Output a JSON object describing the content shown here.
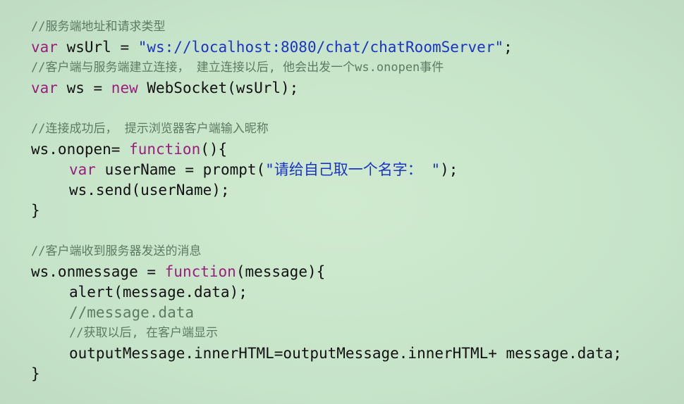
{
  "code": {
    "c1": "//服务端地址和请求类型",
    "l1": {
      "kw": "var",
      "rest": " wsUrl = ",
      "str": "\"ws://localhost:8080/chat/chatRoomServer\"",
      "end": ";"
    },
    "c2": "//客户端与服务端建立连接， 建立连接以后, 他会出发一个ws.onopen事件",
    "l2": {
      "kw": "var",
      "rest1": " ws = ",
      "kw2": "new",
      "rest2": " WebSocket(wsUrl);"
    },
    "c3": "//连接成功后， 提示浏览器客户端输入昵称",
    "l3": {
      "pre": "ws.onopen= ",
      "kw": "function",
      "post": "(){"
    },
    "l4": {
      "kw": "var",
      "rest": " userName = prompt(",
      "str": "\"请给自己取一个名字： \"",
      "end": ");"
    },
    "l5": "ws.send(userName);",
    "l6": "}",
    "c4": "//客户端收到服务器发送的消息",
    "l7": {
      "pre": "ws.onmessage = ",
      "kw": "function",
      "post": "(message){"
    },
    "l8": "alert(message.data);",
    "l9": "//message.data",
    "c5": "//获取以后, 在客户端显示",
    "l10": "outputMessage.innerHTML=outputMessage.innerHTML+ message.data;",
    "l11": "}"
  },
  "colors": {
    "background": "#c8e6cc",
    "keyword": "#9b1d7d",
    "string": "#1b33c6",
    "comment": "#5c7b63",
    "text": "#111111"
  }
}
